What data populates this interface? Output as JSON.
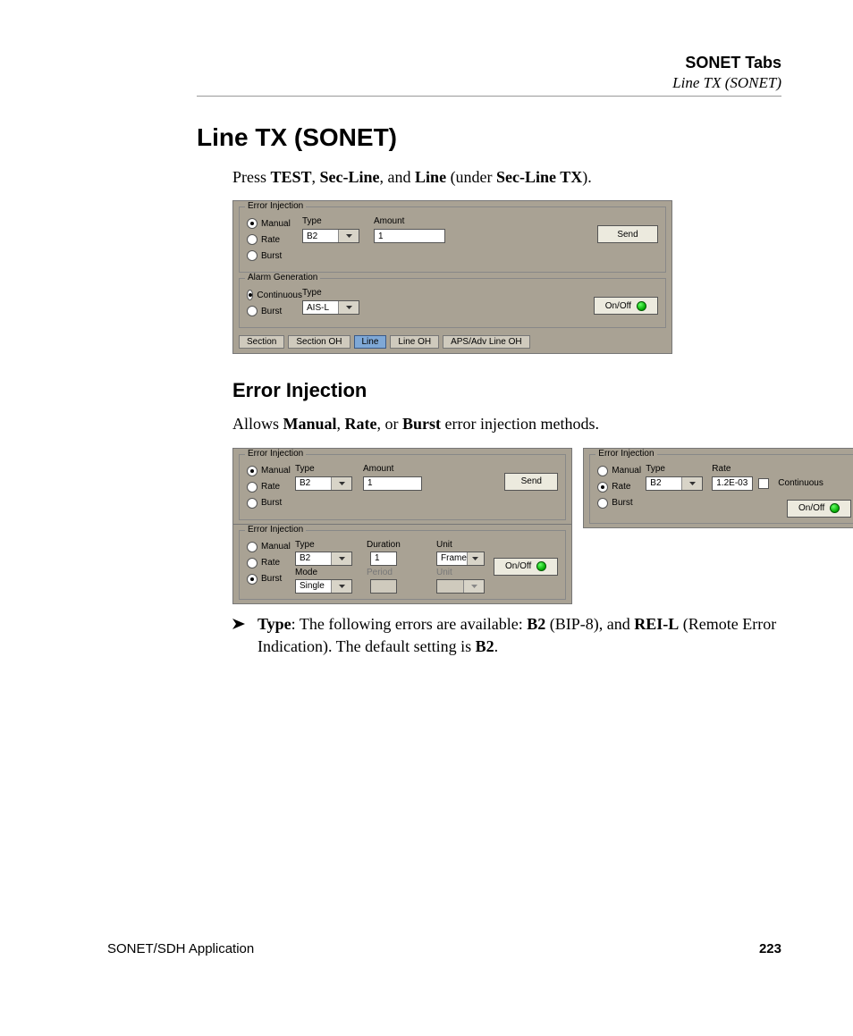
{
  "header": {
    "chapter": "SONET Tabs",
    "section": "Line TX (SONET)"
  },
  "title": "Line TX (SONET)",
  "intro_press": "Press ",
  "intro_b1": "TEST",
  "intro_s1": ", ",
  "intro_b2": "Sec-Line",
  "intro_s2": ", and ",
  "intro_b3": "Line",
  "intro_s3": " (under ",
  "intro_b4": "Sec-Line TX",
  "intro_s4": ").",
  "panel1": {
    "err_legend": "Error Injection",
    "radios": [
      "Manual",
      "Rate",
      "Burst"
    ],
    "selected": 0,
    "type_label": "Type",
    "type_value": "B2",
    "amount_label": "Amount",
    "amount_value": "1",
    "send": "Send",
    "alarm_legend": "Alarm Generation",
    "alarm_radios": [
      "Continuous",
      "Burst"
    ],
    "alarm_selected": 0,
    "alarm_type_label": "Type",
    "alarm_type_value": "AIS-L",
    "onoff": "On/Off",
    "tabs": [
      "Section",
      "Section OH",
      "Line",
      "Line OH",
      "APS/Adv Line OH"
    ],
    "tab_active": 2
  },
  "sub": "Error Injection",
  "sub_intro_a": "Allows ",
  "sub_intro_b1": "Manual",
  "sub_intro_s1": ", ",
  "sub_intro_b2": "Rate",
  "sub_intro_s2": ", or ",
  "sub_intro_b3": "Burst",
  "sub_intro_s3": " error injection methods.",
  "p2": {
    "legend": "Error Injection",
    "radios": [
      "Manual",
      "Rate",
      "Burst"
    ],
    "selected": 0,
    "type_label": "Type",
    "type_value": "B2",
    "amount_label": "Amount",
    "amount_value": "1",
    "send": "Send"
  },
  "p3": {
    "legend": "Error Injection",
    "radios": [
      "Manual",
      "Rate",
      "Burst"
    ],
    "selected": 2,
    "type_label": "Type",
    "type_value": "B2",
    "mode_label": "Mode",
    "mode_value": "Single",
    "duration_label": "Duration",
    "duration_value": "1",
    "period_label": "Period",
    "period_value": "",
    "unit_label": "Unit",
    "unit_value": "Frames",
    "unit2_label": "Unit",
    "unit2_value": "",
    "onoff": "On/Off"
  },
  "p4": {
    "legend": "Error Injection",
    "radios": [
      "Manual",
      "Rate",
      "Burst"
    ],
    "selected": 1,
    "type_label": "Type",
    "type_value": "B2",
    "rate_label": "Rate",
    "rate_value": "1.2E-03",
    "cont_label": "Continuous",
    "onoff": "On/Off"
  },
  "bullet": {
    "b1": "Type",
    "s1": ": The following errors are available: ",
    "b2": "B2",
    "s2": " (BIP-8), and ",
    "b3": "REI-L",
    "s3": " (Remote Error Indication). The default setting is ",
    "b4": "B2",
    "s4": "."
  },
  "footer": {
    "app": "SONET/SDH Application",
    "page": "223"
  }
}
